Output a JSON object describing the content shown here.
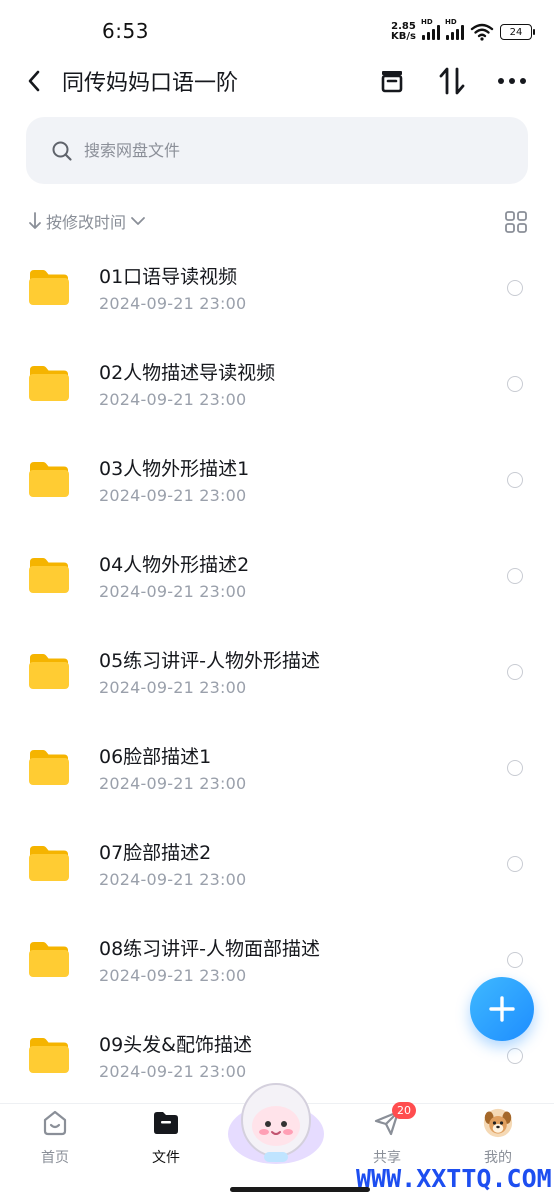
{
  "status_bar": {
    "time": "6:53",
    "net_speed_value": "2.85",
    "net_speed_unit": "KB/s",
    "hd_label": "HD",
    "battery": "24"
  },
  "header": {
    "title": "同传妈妈口语一阶",
    "icons": [
      "back-icon",
      "archive-icon",
      "sort-icon",
      "more-icon"
    ]
  },
  "search": {
    "placeholder": "搜索网盘文件"
  },
  "sort": {
    "label": "按修改时间"
  },
  "files": [
    {
      "name": "01口语导读视频",
      "date": "2024-09-21  23:00"
    },
    {
      "name": "02人物描述导读视频",
      "date": "2024-09-21  23:00"
    },
    {
      "name": "03人物外形描述1",
      "date": "2024-09-21  23:00"
    },
    {
      "name": "04人物外形描述2",
      "date": "2024-09-21  23:00"
    },
    {
      "name": "05练习讲评-人物外形描述",
      "date": "2024-09-21  23:00"
    },
    {
      "name": "06脸部描述1",
      "date": "2024-09-21  23:00"
    },
    {
      "name": "07脸部描述2",
      "date": "2024-09-21  23:00"
    },
    {
      "name": "08练习讲评-人物面部描述",
      "date": "2024-09-21  23:00"
    },
    {
      "name": "09头发&配饰描述",
      "date": "2024-09-21  23:00"
    }
  ],
  "nav": {
    "home": "首页",
    "files": "文件",
    "share": "共享",
    "share_badge": "20",
    "mine": "我的"
  },
  "watermark": "WWW.XXTTQ.COM",
  "colors": {
    "accent": "#1e8dff",
    "folder": "#ffcc33",
    "badge": "#ff4d4f",
    "watermark": "#1d4ef0"
  }
}
